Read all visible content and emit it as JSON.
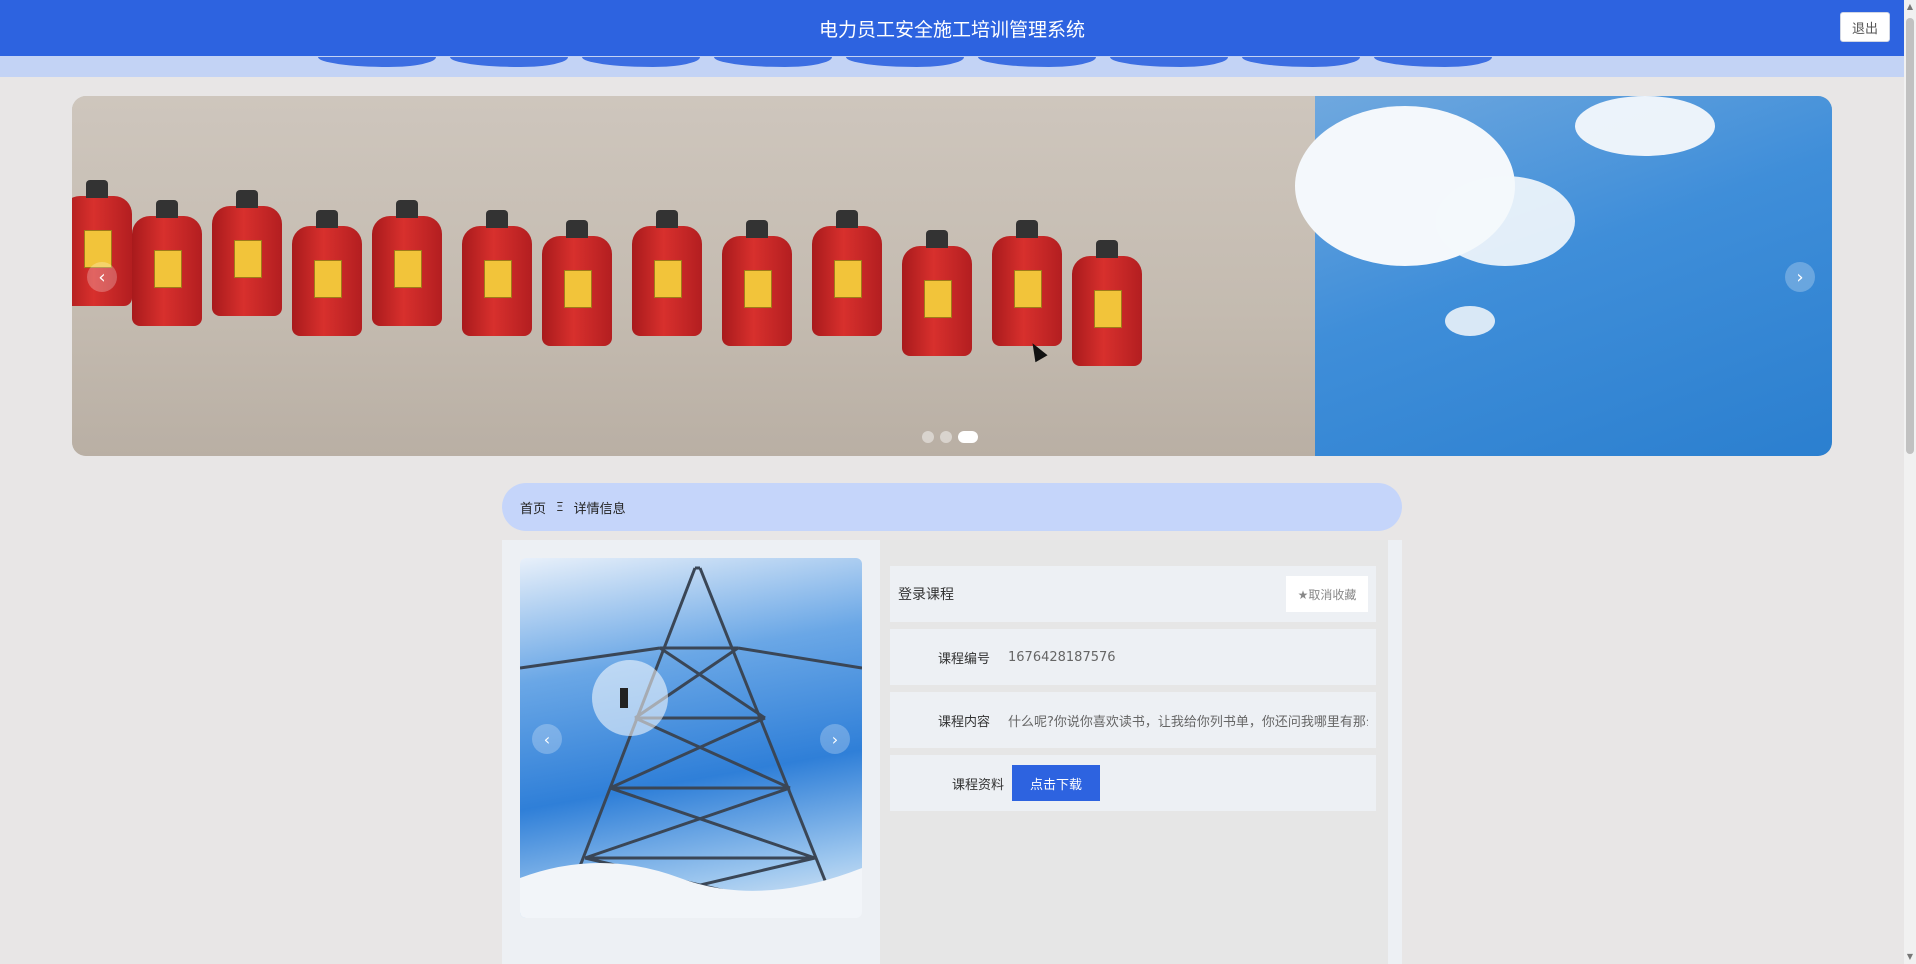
{
  "header": {
    "title": "电力员工安全施工培训管理系统",
    "logout_label": "退出"
  },
  "carousel": {
    "prev_icon": "‹",
    "next_icon": "›",
    "slide_count": 3,
    "active_slide": 3
  },
  "breadcrumb": {
    "home": "首页",
    "separator": "Ξ",
    "current": "详情信息"
  },
  "detail": {
    "title": "登录课程",
    "favorite_label": "★取消收藏",
    "rows": [
      {
        "label": "课程编号",
        "value": "1676428187576"
      },
      {
        "label": "课程内容",
        "value": "什么呢?你说你喜欢读书，让我给你列书单，你还问我哪里有那么"
      },
      {
        "label": "课程资料",
        "button": "点击下载"
      }
    ],
    "img_prev_icon": "‹",
    "img_next_icon": "›"
  },
  "colors": {
    "primary": "#2d63e0",
    "nav_strip": "#c3d3f5",
    "breadcrumb_bg": "#c5d5fa",
    "page_bg": "#e8e6e6"
  }
}
